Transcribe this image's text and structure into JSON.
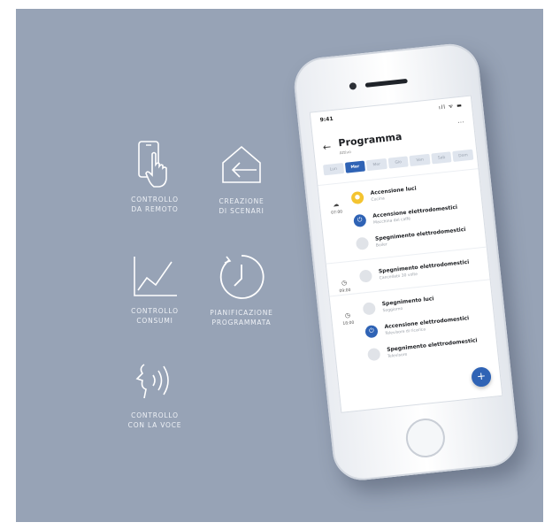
{
  "features": [
    {
      "line1": "CONTROLLO",
      "line2": "DA REMOTO",
      "icon": "phone-touch-icon"
    },
    {
      "line1": "CREAZIONE",
      "line2": "DI SCENARI",
      "icon": "home-arrow-icon"
    },
    {
      "line1": "CONTROLLO",
      "line2": "CONSUMI",
      "icon": "chart-line-icon"
    },
    {
      "line1": "PIANIFICAZIONE",
      "line2": "PROGRAMMATA",
      "icon": "clock-icon"
    },
    {
      "line1": "CONTROLLO",
      "line2": "CON LA VOCE",
      "icon": "voice-icon"
    }
  ],
  "phone": {
    "status_time": "9:41",
    "status_icons": "ıll ᯤ ▬",
    "more": "···",
    "back": "←",
    "title": "Programma",
    "subtitle": "Attivo",
    "days": [
      "Lun",
      "Mar",
      "Mer",
      "Gio",
      "Ven",
      "Sab",
      "Dom"
    ],
    "fab": "+",
    "groups": [
      {
        "symbol": "☁",
        "time": "07:00",
        "items": [
          {
            "title": "Accensione luci",
            "sub": "Cucina"
          },
          {
            "title": "Accensione elettrodomestici",
            "sub": "Macchina del caffè"
          },
          {
            "title": "Spegnimento elettrodomestici",
            "sub": "Boiler"
          }
        ]
      },
      {
        "symbol": "◷",
        "time": "09:00",
        "items": [
          {
            "title": "Spegnimento elettrodomestici",
            "sub": "Cancellato 30 volte"
          }
        ]
      },
      {
        "symbol": "◷",
        "time": "18:00",
        "items": [
          {
            "title": "Spegnimento luci",
            "sub": "Soggiorno"
          },
          {
            "title": "Accensione elettrodomestici",
            "sub": "Televisore di ricarica"
          },
          {
            "title": "Spegnimento elettrodomestici",
            "sub": "Televisore"
          }
        ]
      }
    ]
  },
  "colors": {
    "background": "#97a3b6",
    "accent_blue": "#2f63b5",
    "accent_yellow": "#f4c430"
  }
}
